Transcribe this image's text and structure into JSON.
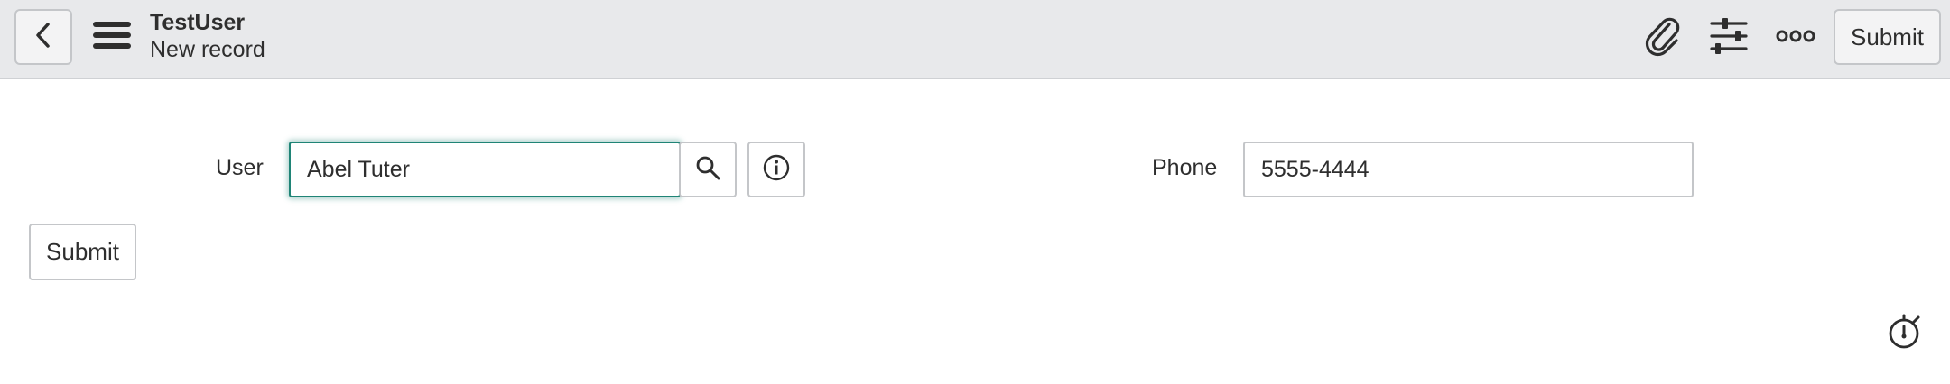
{
  "header": {
    "title": "TestUser",
    "subtitle": "New record",
    "submit_label": "Submit",
    "icons": [
      "back-icon",
      "hamburger-menu-icon",
      "paperclip-icon",
      "sliders-icon",
      "more-options-icon"
    ]
  },
  "form": {
    "user_label": "User",
    "user_value": "Abel Tuter",
    "phone_label": "Phone",
    "phone_value": "5555-4444",
    "submit_label": "Submit",
    "icons": [
      "search-icon",
      "info-icon",
      "stopwatch-icon"
    ]
  },
  "colors": {
    "header_bg": "#e8e9eb",
    "focus_border": "#1f8476",
    "text": "#2e2e2e"
  }
}
